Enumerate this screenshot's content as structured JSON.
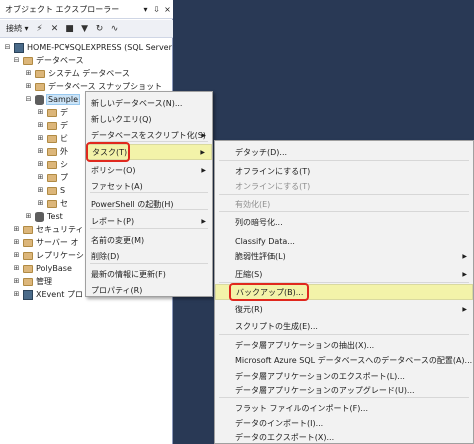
{
  "object_explorer": {
    "title": "オブジェクト エクスプローラー",
    "title_buttons": [
      "▾",
      "⇩",
      "×"
    ],
    "toolbar": {
      "connect_label": "接続 ▾"
    },
    "tree": [
      {
        "label": "HOME-PC¥SQLEXPRESS (SQL Server",
        "expander": "⊟",
        "icon": "server"
      },
      {
        "label": "データベース",
        "expander": "⊟",
        "icon": "folder"
      },
      {
        "label": "システム データベース",
        "expander": "⊞",
        "icon": "folder"
      },
      {
        "label": "データベース スナップショット",
        "expander": "⊞",
        "icon": "folder"
      },
      {
        "label": "Sample",
        "expander": "⊟",
        "icon": "database",
        "selected": true
      },
      {
        "label": "デ",
        "expander": "⊞",
        "icon": "folder"
      },
      {
        "label": "デ",
        "expander": "⊞",
        "icon": "folder"
      },
      {
        "label": "ビ",
        "expander": "⊞",
        "icon": "folder"
      },
      {
        "label": "外",
        "expander": "⊞",
        "icon": "folder"
      },
      {
        "label": "シ",
        "expander": "⊞",
        "icon": "folder"
      },
      {
        "label": "プ",
        "expander": "⊞",
        "icon": "folder"
      },
      {
        "label": "S",
        "expander": "⊞",
        "icon": "folder"
      },
      {
        "label": "セ",
        "expander": "⊞",
        "icon": "folder"
      },
      {
        "label": "Test",
        "expander": "⊞",
        "icon": "database"
      },
      {
        "label": "セキュリティ",
        "expander": "⊞",
        "icon": "folder"
      },
      {
        "label": "サーバー オ",
        "expander": "⊞",
        "icon": "folder"
      },
      {
        "label": "レプリケーシ",
        "expander": "⊞",
        "icon": "folder"
      },
      {
        "label": "PolyBase",
        "expander": "⊞",
        "icon": "folder"
      },
      {
        "label": "管理",
        "expander": "⊞",
        "icon": "folder"
      },
      {
        "label": "XEvent プロ",
        "expander": "⊞",
        "icon": "xevent"
      }
    ]
  },
  "context_menu": {
    "items": [
      {
        "label": "新しいデータベース(N)...",
        "arrow": false
      },
      {
        "label": "新しいクエリ(Q)",
        "arrow": false
      },
      {
        "label": "データベースをスクリプト化(S)",
        "arrow": true
      },
      {
        "label": "タスク(T)",
        "arrow": true,
        "highlighted": true
      },
      {
        "label": "ポリシー(O)",
        "arrow": true
      },
      {
        "label": "ファセット(A)",
        "arrow": false
      },
      {
        "label": "PowerShell の起動(H)",
        "arrow": false
      },
      {
        "label": "レポート(P)",
        "arrow": true
      },
      {
        "label": "名前の変更(M)",
        "arrow": false
      },
      {
        "label": "削除(D)",
        "arrow": false
      },
      {
        "label": "最新の情報に更新(F)",
        "arrow": false
      },
      {
        "label": "プロパティ(R)",
        "arrow": false
      }
    ]
  },
  "tasks_submenu": {
    "items": [
      {
        "label": "デタッチ(D)...",
        "arrow": false
      },
      {
        "label": "オフラインにする(T)",
        "arrow": false
      },
      {
        "label": "オンラインにする(T)",
        "arrow": false,
        "disabled": true
      },
      {
        "label": "有効化(E)",
        "arrow": false,
        "disabled": true
      },
      {
        "label": "列の暗号化...",
        "arrow": false
      },
      {
        "label": "Classify Data...",
        "arrow": false
      },
      {
        "label": "脆弱性評価(L)",
        "arrow": true
      },
      {
        "label": "圧縮(S)",
        "arrow": true
      },
      {
        "label": "バックアップ(B)...",
        "arrow": false,
        "highlighted": true
      },
      {
        "label": "復元(R)",
        "arrow": true
      },
      {
        "label": "スクリプトの生成(E)...",
        "arrow": false
      },
      {
        "label": "データ層アプリケーションの抽出(X)...",
        "arrow": false
      },
      {
        "label": "Microsoft Azure SQL データベースへのデータベースの配置(A)...",
        "arrow": false
      },
      {
        "label": "データ層アプリケーションのエクスポート(L)...",
        "arrow": false
      },
      {
        "label": "データ層アプリケーションのアップグレード(U)...",
        "arrow": false
      },
      {
        "label": "フラット ファイルのインポート(F)...",
        "arrow": false
      },
      {
        "label": "データのインポート(I)...",
        "arrow": false
      },
      {
        "label": "データのエクスポート(X)...",
        "arrow": false
      }
    ]
  }
}
